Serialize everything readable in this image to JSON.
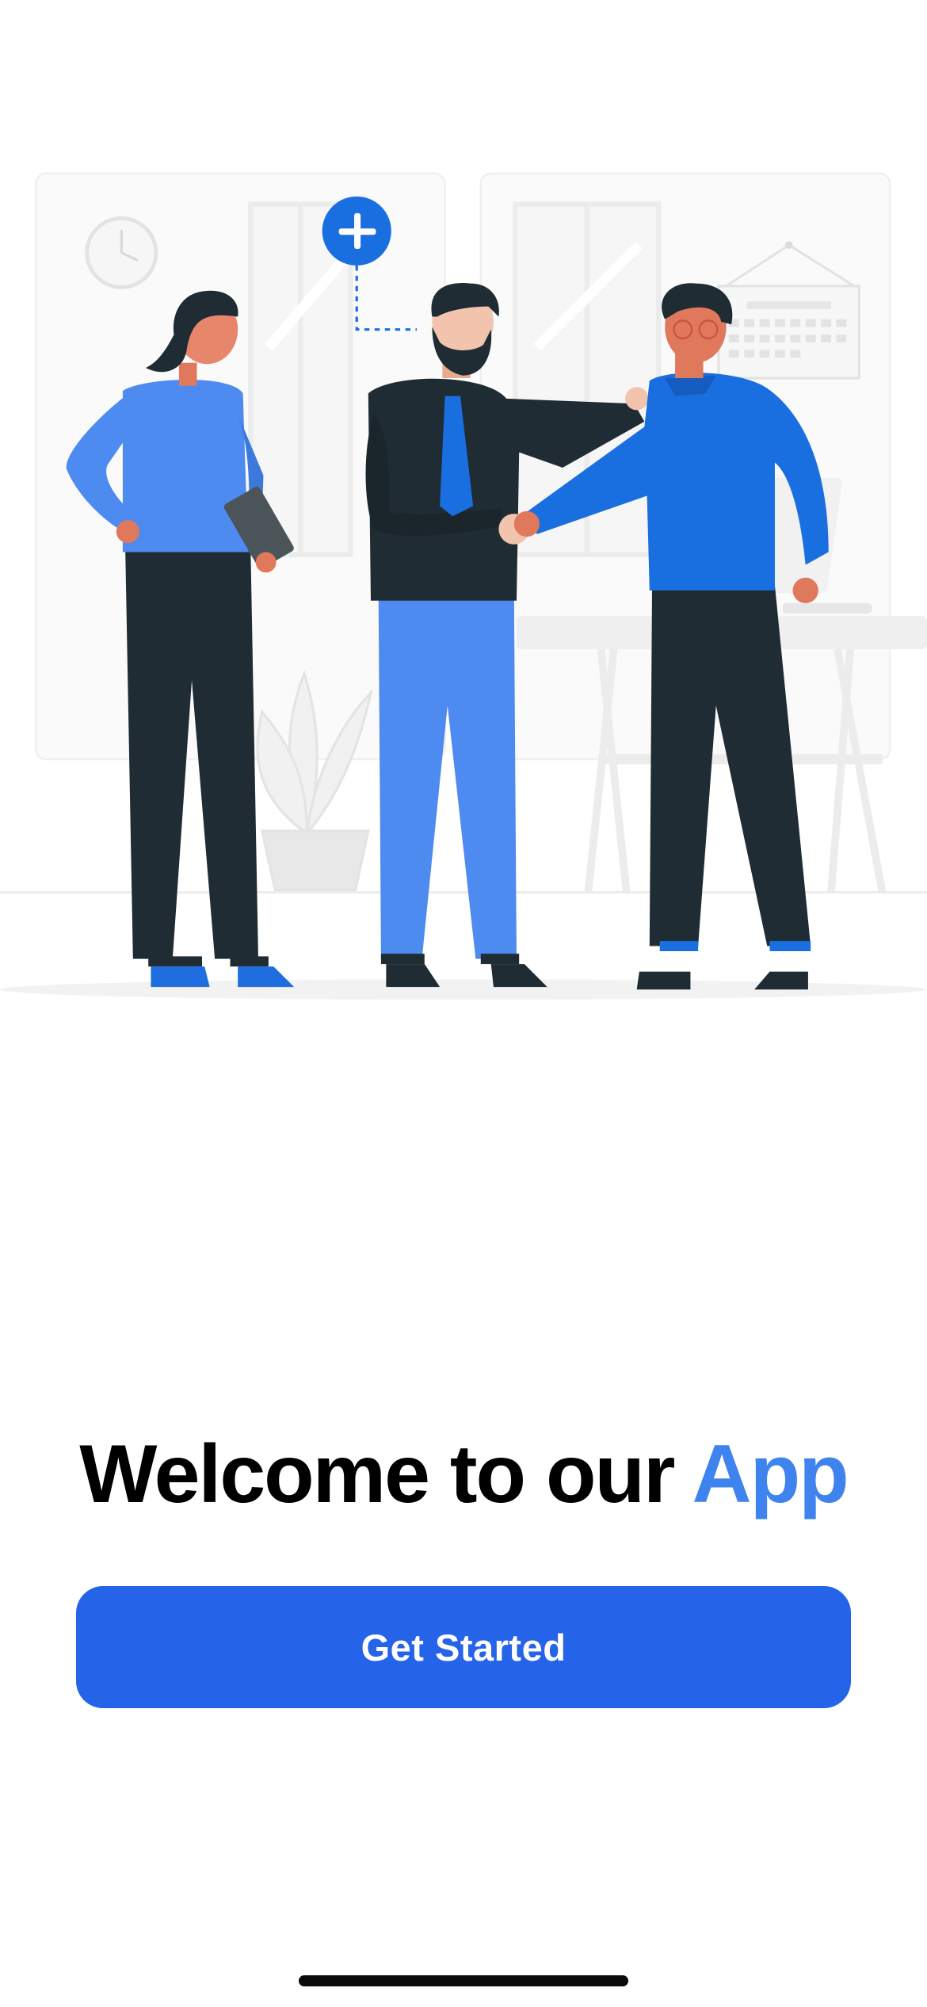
{
  "welcome": {
    "title_main": "Welcome to our ",
    "title_accent": "App"
  },
  "actions": {
    "get_started_label": "Get Started"
  },
  "illustration": {
    "icon": "plus-icon",
    "subjects": [
      "team-handshake"
    ]
  },
  "colors": {
    "accent": "#3E83EE",
    "button": "#2563E8",
    "text": "#000000",
    "background": "#FFFFFF"
  }
}
